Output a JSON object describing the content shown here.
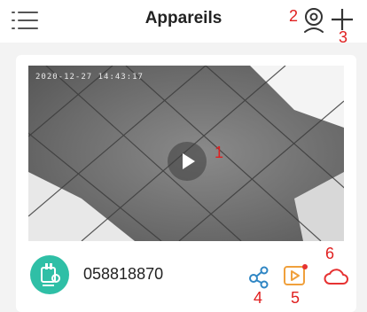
{
  "header": {
    "title": "Appareils",
    "menu_icon": "menu-icon",
    "camera_icon": "camera-icon",
    "add_icon": "plus-icon"
  },
  "annotations": {
    "n1": "1",
    "n2": "2",
    "n3": "3",
    "n4": "4",
    "n5": "5",
    "n6": "6",
    "color": "#e02020"
  },
  "device": {
    "timestamp": "2020-12-27 14:43:17",
    "name": "058818870",
    "play_icon": "play-icon",
    "share_icon": "share-icon",
    "playback_icon": "video-playback-icon",
    "cloud_icon": "cloud-icon"
  },
  "colors": {
    "accent": "#2f86c4",
    "brand_teal": "#2fbfa6",
    "alert_orange": "#f0a03c",
    "alert_red": "#e63232"
  }
}
